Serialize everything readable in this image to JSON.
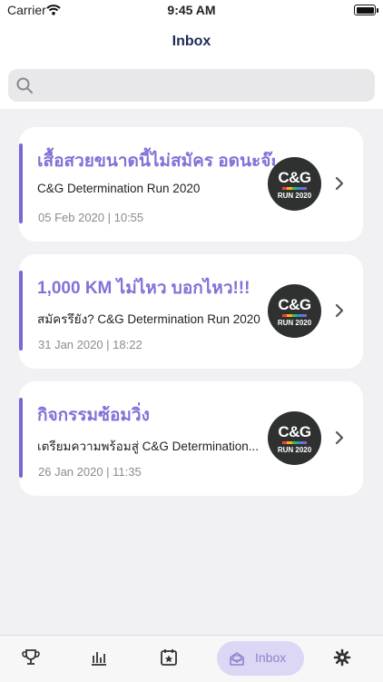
{
  "status_bar": {
    "carrier": "Carrier",
    "time": "9:45 AM"
  },
  "header": {
    "title": "Inbox"
  },
  "search": {
    "placeholder": ""
  },
  "accent_color": "#7868d6",
  "messages": [
    {
      "title": "เสื้อสวยขนาดนี้ไม่สมัคร อดนะจ๊ะ",
      "subtitle": "C&G Determination Run 2020",
      "date": "05 Feb 2020 | 10:55",
      "logo_text": "C&G",
      "logo_subtext": "RUN 2020"
    },
    {
      "title": "1,000 KM ไม่ไหว บอกไหว!!!",
      "subtitle": "สมัครรึยัง? C&G Determination Run 2020",
      "date": "31 Jan 2020 | 18:22",
      "logo_text": "C&G",
      "logo_subtext": "RUN 2020"
    },
    {
      "title": "กิจกรรมซ้อมวิ่ง",
      "subtitle": "เตรียมความพร้อมสู่ C&G Determination...",
      "date": "26 Jan 2020 | 11:35",
      "logo_text": "C&G",
      "logo_subtext": "RUN 2020"
    }
  ],
  "tab_bar": {
    "tabs": [
      {
        "icon": "trophy-icon"
      },
      {
        "icon": "bar-chart-icon"
      },
      {
        "icon": "star-calendar-icon"
      },
      {
        "icon": "inbox-icon",
        "label": "Inbox",
        "active": true
      },
      {
        "icon": "gear-icon"
      }
    ]
  }
}
